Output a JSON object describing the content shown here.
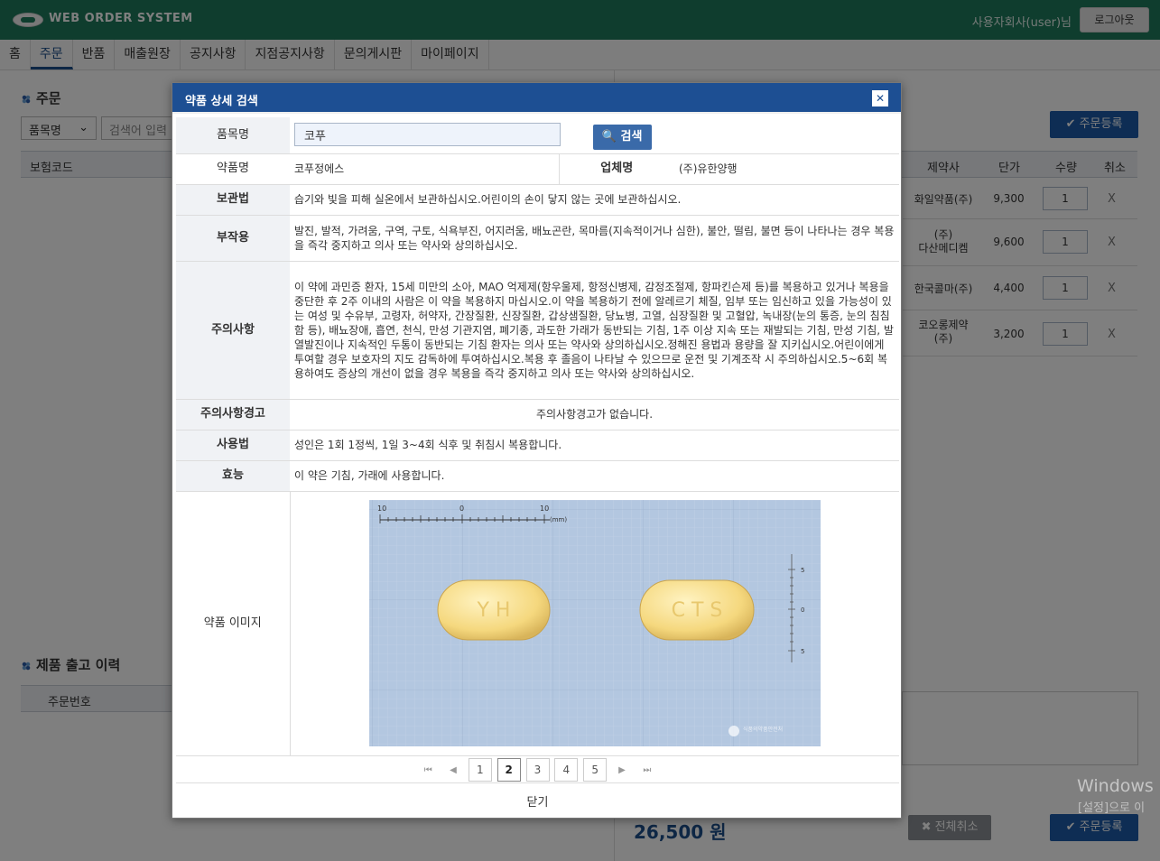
{
  "header": {
    "brand": "WEB ORDER SYSTEM",
    "user": "사용자회사(user)님",
    "logout": "로그아웃"
  },
  "nav": [
    "홈",
    "주문",
    "반품",
    "매출원장",
    "공지사항",
    "지점공지사항",
    "문의게시판",
    "마이페이지"
  ],
  "order": {
    "title": "주문",
    "filter_select": "품목명",
    "search_placeholder": "검색어 입력",
    "register_button": "주문등록",
    "columns": {
      "code": "보험코드",
      "maker": "제약사",
      "price": "단가",
      "qty": "수량",
      "cancel": "취소"
    },
    "rows": [
      {
        "maker": "화일약품(주)",
        "price": "9,300",
        "qty": "1",
        "cancel": "X"
      },
      {
        "maker": "(주)\n다산메디켐",
        "price": "9,600",
        "qty": "1",
        "cancel": "X"
      },
      {
        "maker": "한국콜마(주)",
        "price": "4,400",
        "qty": "1",
        "cancel": "X"
      },
      {
        "maker": "코오롱제약\n(주)",
        "price": "3,200",
        "qty": "1",
        "cancel": "X"
      }
    ],
    "total": "26,500 원",
    "cancel_all": "전체취소",
    "register_button2": "주문등록"
  },
  "history": {
    "title": "제품 출고 이력",
    "col_order_no": "주문번호"
  },
  "modal": {
    "title": "약품 상세 검색",
    "close_icon": "close-icon",
    "search_label": "품목명",
    "search_value": "코푸",
    "search_button": "검색",
    "fields": {
      "drug_name_label": "약품명",
      "drug_name": "코푸정에스",
      "company_label": "업체명",
      "company": "(주)유한양행",
      "storage_label": "보관법",
      "storage": "습기와 빛을 피해 실온에서 보관하십시오.어린이의 손이 닿지 않는 곳에 보관하십시오.",
      "side_effects_label": "부작용",
      "side_effects": "발진, 발적, 가려움, 구역, 구토, 식욕부진, 어지러움, 배뇨곤란, 목마름(지속적이거나 심한), 불안, 떨림, 불면 등이 나타나는 경우 복용을 즉각 중지하고 의사 또는 약사와 상의하십시오.",
      "cautions_label": "주의사항",
      "cautions": "이 약에 과민증 환자, 15세 미만의 소아, MAO 억제제(항우울제, 항정신병제, 감정조절제, 항파킨슨제 등)를 복용하고 있거나 복용을 중단한 후 2주 이내의 사람은 이 약을 복용하지 마십시오.이 약을 복용하기 전에 알레르기 체질, 임부 또는 임신하고 있을 가능성이 있는 여성 및 수유부, 고령자, 허약자, 간장질환, 신장질환, 갑상샘질환, 당뇨병, 고열, 심장질환 및 고혈압, 녹내장(눈의 통증, 눈의 침침함 등), 배뇨장애, 흡연, 천식, 만성 기관지염, 폐기종, 과도한 가래가 동반되는 기침, 1주 이상 지속 또는 재발되는 기침, 만성 기침, 발열발진이나 지속적인 두통이 동반되는 기침 환자는 의사 또는 약사와 상의하십시오.정해진 용법과 용량을 잘 지키십시오.어린이에게 투여할 경우 보호자의 지도 감독하에 투여하십시오.복용 후 졸음이 나타날 수 있으므로 운전 및 기계조작 시 주의하십시오.5~6회 복용하여도 증상의 개선이 없을 경우 복용을 즉각 중지하고 의사 또는 약사와 상의하십시오.",
      "warning_label": "주의사항경고",
      "warning": "주의사항경고가 없습니다.",
      "usage_label": "사용법",
      "usage": "성인은 1회 1정씩, 1일 3~4회 식후 및 취침시 복용합니다.",
      "effect_label": "효능",
      "effect": "이 약은 기침, 가래에 사용합니다.",
      "image_label": "약품 이미지"
    },
    "image": {
      "ruler_ticks_top": [
        "10",
        "0",
        "10"
      ],
      "ruler_unit": "(mm)",
      "ruler_ticks_side": [
        "5",
        "0",
        "5"
      ],
      "pill_left_text": "Y H",
      "pill_right_text": "C T S",
      "watermark": "식품의약품안전처"
    },
    "pager": {
      "pages": [
        "1",
        "2",
        "3",
        "4",
        "5"
      ],
      "current": "2"
    },
    "close_text": "닫기"
  },
  "watermark": {
    "line1": "Windows",
    "line2": "[설정]으로 이"
  }
}
